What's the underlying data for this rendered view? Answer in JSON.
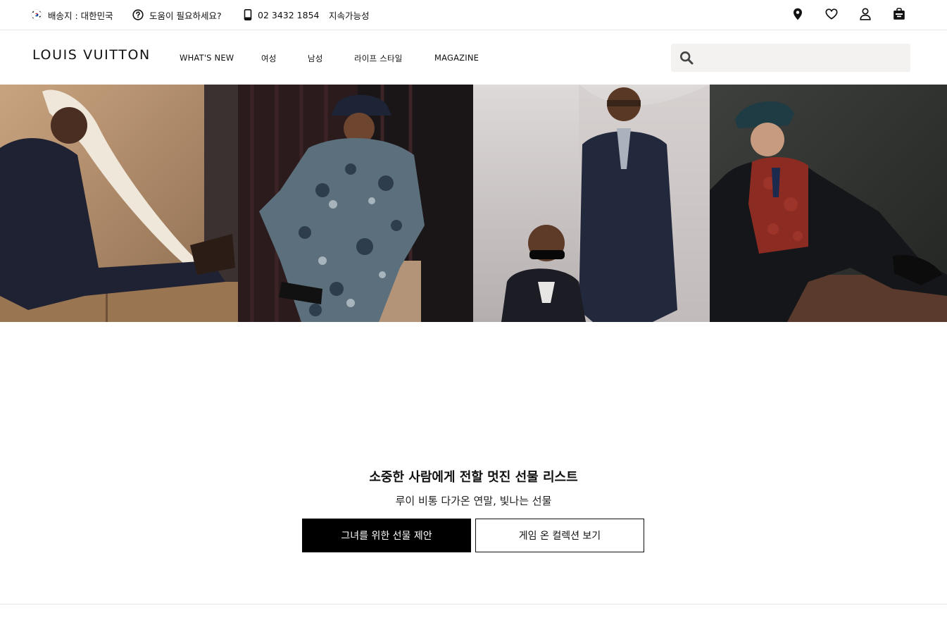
{
  "topbar": {
    "shipping_label": "배송지 : 대한민국",
    "help_label": "도움이 필요하세요?",
    "phone": "02 3432 1854",
    "sustainability": "지속가능성",
    "icons": [
      "flag-korea-icon",
      "help-circle-icon",
      "phone-icon",
      "location-pin-icon",
      "heart-icon",
      "account-icon",
      "shopping-bag-icon"
    ]
  },
  "header": {
    "logo": "LOUIS VUITTON",
    "nav": [
      "WHAT'S NEW",
      "여성",
      "남성",
      "라이프 스타일",
      "MAGAZINE"
    ],
    "search_placeholder": ""
  },
  "hero": {
    "panels": [
      "panel-1",
      "panel-2",
      "panel-3",
      "panel-4"
    ]
  },
  "promo": {
    "title": "소중한 사람에게 전할 멋진 선물 리스트",
    "subtitle": "루이 비통 다가온 연말, 빛나는 선물",
    "primary_button": "그녀를 위한 선물 제안",
    "secondary_button": "게임 온 컬렉션 보기"
  },
  "colors": {
    "primary_button_bg": "#000000",
    "search_bg": "#f3f2f1",
    "divider": "#e6e6e6"
  }
}
